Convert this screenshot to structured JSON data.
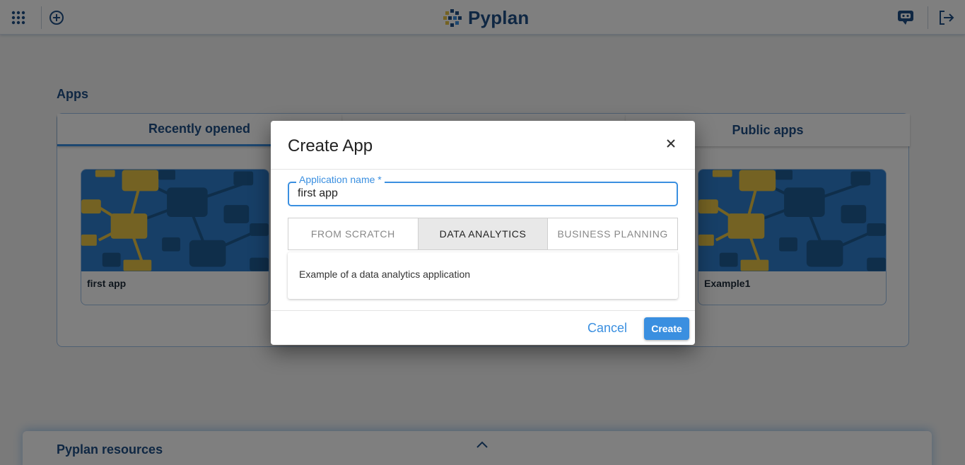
{
  "header": {
    "brand": "Pyplan"
  },
  "apps": {
    "title": "Apps",
    "tabs": [
      {
        "label": "Recently opened"
      },
      {
        "label": "Public apps"
      }
    ],
    "cards": [
      {
        "label": "first app"
      },
      {
        "label": "Example1"
      }
    ]
  },
  "resources": {
    "title": "Pyplan resources"
  },
  "dialog": {
    "title": "Create App",
    "field_label": "Application name *",
    "field_value": "first app",
    "options": [
      "FROM SCRATCH",
      "DATA ANALYTICS",
      "BUSINESS PLANNING"
    ],
    "selected_option": "DATA ANALYTICS",
    "description": "Example of a data analytics application",
    "cancel_label": "Cancel",
    "create_label": "Create"
  },
  "colors": {
    "accent": "#3a8fe0",
    "brand": "#1e4f86",
    "thumb_blue": "#2f7fcf",
    "thumb_gold": "#e8c547",
    "thumb_dark": "#1f5c95"
  }
}
